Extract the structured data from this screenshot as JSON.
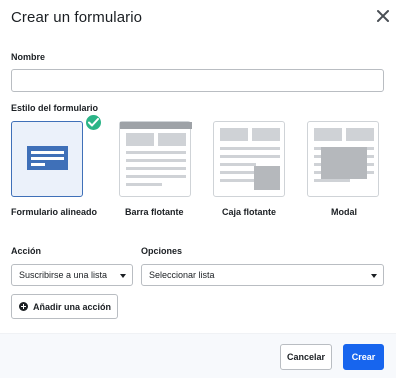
{
  "dialog": {
    "title": "Crear un formulario",
    "close_icon": "close-icon"
  },
  "name_field": {
    "label": "Nombre",
    "value": "",
    "placeholder": ""
  },
  "form_style": {
    "label": "Estilo del formulario",
    "selected": "Formulario alineado",
    "options": [
      {
        "label": "Formulario alineado",
        "icon": "inline-form-icon"
      },
      {
        "label": "Barra flotante",
        "icon": "floating-bar-icon"
      },
      {
        "label": "Caja flotante",
        "icon": "floating-box-icon"
      },
      {
        "label": "Modal",
        "icon": "modal-icon"
      }
    ]
  },
  "action": {
    "label": "Acción",
    "value": "Suscribirse a una lista"
  },
  "options": {
    "label": "Opciones",
    "value": "Seleccionar lista"
  },
  "add_action": {
    "label": "Añadir una acción",
    "icon": "plus-circle-icon"
  },
  "footer": {
    "cancel_label": "Cancelar",
    "create_label": "Crear"
  },
  "colors": {
    "accent": "#1765ee",
    "selected_bg": "#ebf1fa",
    "selected_border": "#3f70b8",
    "check": "#2bb487",
    "thumbnail_block": "#b5b8bc",
    "thumbnail_line": "#cfd2d6"
  }
}
